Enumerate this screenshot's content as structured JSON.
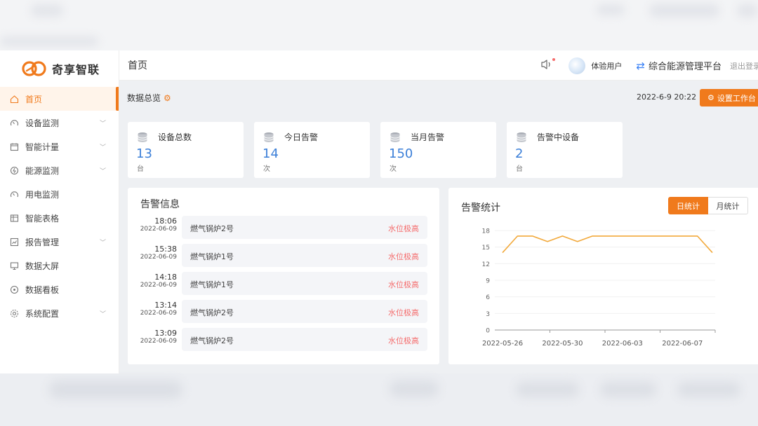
{
  "app": {
    "logo_text": "奇享智联"
  },
  "sidebar": {
    "items": [
      {
        "label": "首页",
        "icon": "home-icon",
        "active": true,
        "expandable": false
      },
      {
        "label": "设备监测",
        "icon": "gauge-icon",
        "active": false,
        "expandable": true
      },
      {
        "label": "智能计量",
        "icon": "calendar-icon",
        "active": false,
        "expandable": true
      },
      {
        "label": "能源监测",
        "icon": "energy-icon",
        "active": false,
        "expandable": true
      },
      {
        "label": "用电监测",
        "icon": "gauge-icon",
        "active": false,
        "expandable": false
      },
      {
        "label": "智能表格",
        "icon": "table-icon",
        "active": false,
        "expandable": false
      },
      {
        "label": "报告管理",
        "icon": "report-icon",
        "active": false,
        "expandable": true
      },
      {
        "label": "数据大屏",
        "icon": "monitor-icon",
        "active": false,
        "expandable": false
      },
      {
        "label": "数据看板",
        "icon": "dashboard-icon",
        "active": false,
        "expandable": false
      },
      {
        "label": "系统配置",
        "icon": "settings-icon",
        "active": false,
        "expandable": true
      }
    ]
  },
  "header": {
    "title": "首页",
    "username": "体验用户",
    "platform": "综合能源管理平台",
    "logout": "退出登录"
  },
  "overview": {
    "title": "数据总览",
    "datetime": "2022-6-9 20:22",
    "settings_button": "设置工作台"
  },
  "stats": [
    {
      "label": "设备总数",
      "value": "13",
      "unit": "台"
    },
    {
      "label": "今日告警",
      "value": "14",
      "unit": "次"
    },
    {
      "label": "当月告警",
      "value": "150",
      "unit": "次"
    },
    {
      "label": "告警中设备",
      "value": "2",
      "unit": "台"
    }
  ],
  "alarms": {
    "title": "告警信息",
    "rows": [
      {
        "time": "18:06",
        "date": "2022-06-09",
        "device": "燃气锅炉2号",
        "level": "水位极高"
      },
      {
        "time": "15:38",
        "date": "2022-06-09",
        "device": "燃气锅炉1号",
        "level": "水位极高"
      },
      {
        "time": "14:18",
        "date": "2022-06-09",
        "device": "燃气锅炉1号",
        "level": "水位极高"
      },
      {
        "time": "13:14",
        "date": "2022-06-09",
        "device": "燃气锅炉2号",
        "level": "水位极高"
      },
      {
        "time": "13:09",
        "date": "2022-06-09",
        "device": "燃气锅炉2号",
        "level": "水位极高"
      }
    ]
  },
  "alarm_stats": {
    "title": "告警统计",
    "tabs": {
      "daily": "日统计",
      "monthly": "月统计"
    }
  },
  "colors": {
    "accent": "#f07a1c",
    "value_blue": "#3b7fd8",
    "alarm_red": "#f56c6c",
    "line": "#f2a93b"
  },
  "chart_data": {
    "type": "line",
    "x": [
      "2022-05-26",
      "2022-05-27",
      "2022-05-28",
      "2022-05-29",
      "2022-05-30",
      "2022-05-31",
      "2022-06-01",
      "2022-06-02",
      "2022-06-03",
      "2022-06-04",
      "2022-06-05",
      "2022-06-06",
      "2022-06-07",
      "2022-06-08",
      "2022-06-09"
    ],
    "series": [
      {
        "values": [
          14,
          17,
          17,
          16,
          17,
          16,
          17,
          17,
          17,
          17,
          17,
          17,
          17,
          17,
          14
        ]
      }
    ],
    "xticks": [
      "2022-05-26",
      "2022-05-30",
      "2022-06-03",
      "2022-06-07"
    ],
    "yticks": [
      0,
      3,
      6,
      9,
      12,
      15,
      18
    ],
    "ylim": [
      0,
      18
    ],
    "grid": true,
    "title": "",
    "xlabel": "",
    "ylabel": ""
  }
}
